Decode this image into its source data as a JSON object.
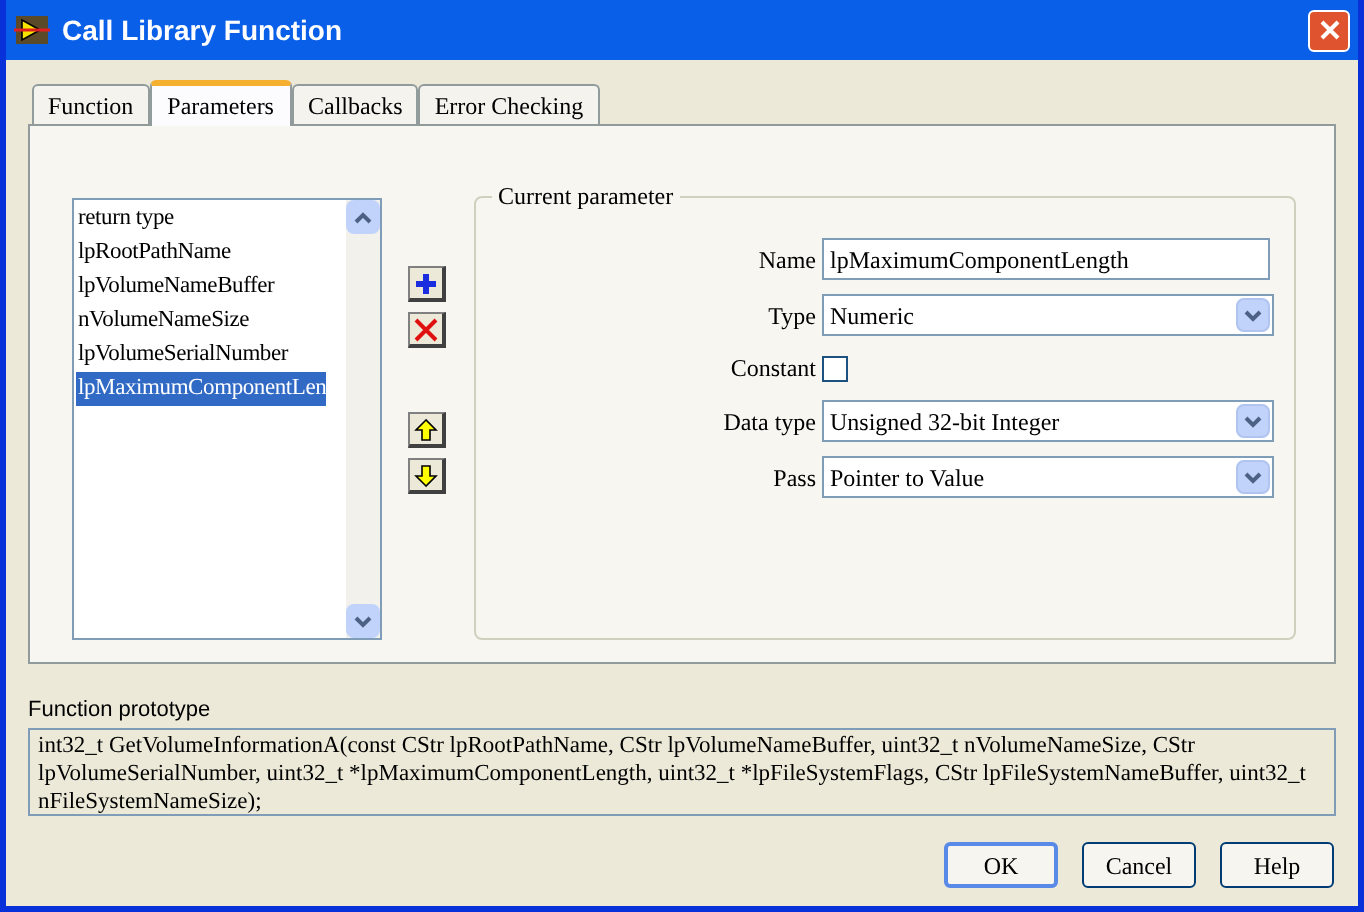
{
  "window": {
    "title": "Call Library Function"
  },
  "tabs": [
    {
      "label": "Function",
      "selected": false
    },
    {
      "label": "Parameters",
      "selected": true
    },
    {
      "label": "Callbacks",
      "selected": false
    },
    {
      "label": "Error Checking",
      "selected": false
    }
  ],
  "parameters": [
    {
      "label": "return type",
      "selected": false
    },
    {
      "label": "lpRootPathName",
      "selected": false
    },
    {
      "label": "lpVolumeNameBuffer",
      "selected": false
    },
    {
      "label": "nVolumeNameSize",
      "selected": false
    },
    {
      "label": "lpVolumeSerialNumber",
      "selected": false
    },
    {
      "label": "lpMaximumComponentLen",
      "selected": true
    }
  ],
  "current_parameter": {
    "title": "Current parameter",
    "name": {
      "label": "Name",
      "value": "lpMaximumComponentLength"
    },
    "type": {
      "label": "Type",
      "value": "Numeric"
    },
    "constant": {
      "label": "Constant",
      "checked": false
    },
    "data_type": {
      "label": "Data type",
      "value": "Unsigned 32-bit Integer"
    },
    "pass": {
      "label": "Pass",
      "value": "Pointer to Value"
    }
  },
  "prototype": {
    "label": "Function prototype",
    "text": "int32_t GetVolumeInformationA(const CStr lpRootPathName, CStr lpVolumeNameBuffer, uint32_t nVolumeNameSize, CStr lpVolumeSerialNumber, uint32_t *lpMaximumComponentLength, uint32_t *lpFileSystemFlags, CStr lpFileSystemNameBuffer, uint32_t nFileSystemNameSize);"
  },
  "buttons": [
    "OK",
    "Cancel",
    "Help"
  ]
}
